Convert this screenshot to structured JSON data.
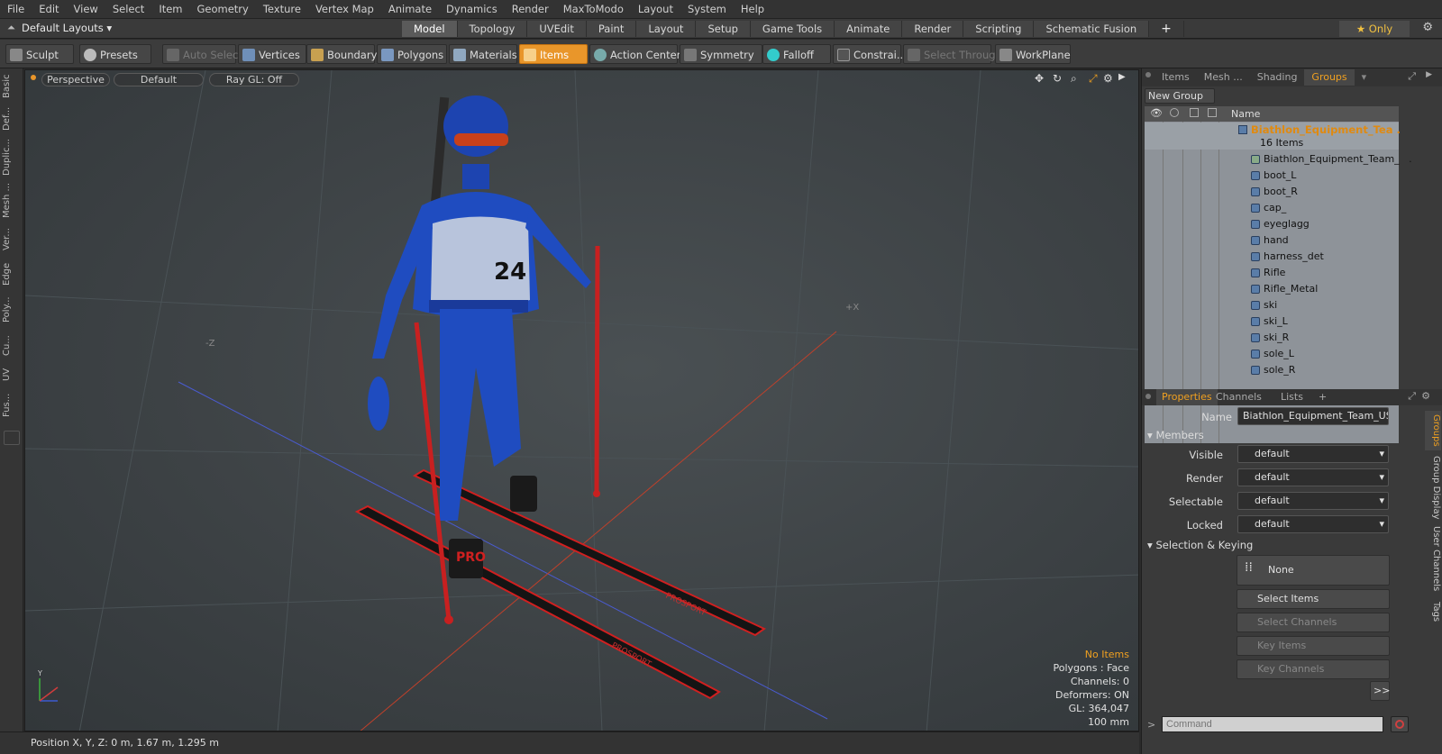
{
  "menu": [
    "File",
    "Edit",
    "View",
    "Select",
    "Item",
    "Geometry",
    "Texture",
    "Vertex Map",
    "Animate",
    "Dynamics",
    "Render",
    "MaxToModo",
    "Layout",
    "System",
    "Help"
  ],
  "layout": {
    "selector": "Default Layouts ▾",
    "only_label": "★  Only"
  },
  "tabs": [
    "Model",
    "Topology",
    "UVEdit",
    "Paint",
    "Layout",
    "Setup",
    "Game Tools",
    "Animate",
    "Render",
    "Scripting",
    "Schematic Fusion"
  ],
  "active_tab": "Model",
  "toolbar": {
    "sculpt": "Sculpt",
    "presets": "Presets",
    "auto_select": "Auto Select",
    "vertices": "Vertices",
    "boundary": "Boundary",
    "polygons": "Polygons",
    "materials": "Materials",
    "items": "Items",
    "action_center": "Action Center",
    "symmetry": "Symmetry",
    "falloff": "Falloff",
    "constraints": "Constrai...",
    "select_through": "Select Through",
    "workplane": "WorkPlane"
  },
  "left_tabs": [
    "Basic",
    "Def...",
    "Duplic...",
    "Mesh ...",
    "Ver...",
    "Edge",
    "Poly...",
    "Cu...",
    "UV",
    "Fus..."
  ],
  "viewport": {
    "perspective": "Perspective",
    "default": "Default",
    "raygl": "Ray GL: Off",
    "info": {
      "no_items": "No Items",
      "polygons": "Polygons : Face",
      "channels": "Channels: 0",
      "deformers": "Deformers: ON",
      "gl": "GL: 364,047",
      "scale": "100 mm"
    },
    "bib_number": "24"
  },
  "status": {
    "position": "Position X, Y, Z:   0 m, 1.67 m, 1.295 m"
  },
  "right_tabs": [
    "Items",
    "Mesh ...",
    "Shading",
    "Groups"
  ],
  "active_right_tab": "Groups",
  "new_group": "New Group",
  "scene_head": "Name",
  "group": {
    "name": "Biathlon_Equipment_Tea ...",
    "count": "16 Items"
  },
  "members": [
    "Biathlon_Equipment_Team_ ...",
    "boot_L",
    "boot_R",
    "cap_",
    "eyeglagg",
    "hand",
    "harness_det",
    "Rifle",
    "Rifle_Metal",
    "ski",
    "ski_L",
    "ski_R",
    "sole_L",
    "sole_R"
  ],
  "props_tabs": [
    "Properties",
    "Channels",
    "Lists"
  ],
  "props": {
    "name_label": "Name",
    "name_value": "Biathlon_Equipment_Team_USA_S",
    "members_section": "Members",
    "visible": "Visible",
    "render": "Render",
    "selectable": "Selectable",
    "locked": "Locked",
    "default": "default",
    "sel_section": "Selection & Keying",
    "none": "None",
    "select_items": "Select Items",
    "select_channels": "Select Channels",
    "key_items": "Key Items",
    "key_channels": "Key Channels",
    "more": ">>"
  },
  "right_vtabs": [
    "Groups",
    "Group Display",
    "User Channels",
    "Tags"
  ],
  "command_placeholder": "Command"
}
